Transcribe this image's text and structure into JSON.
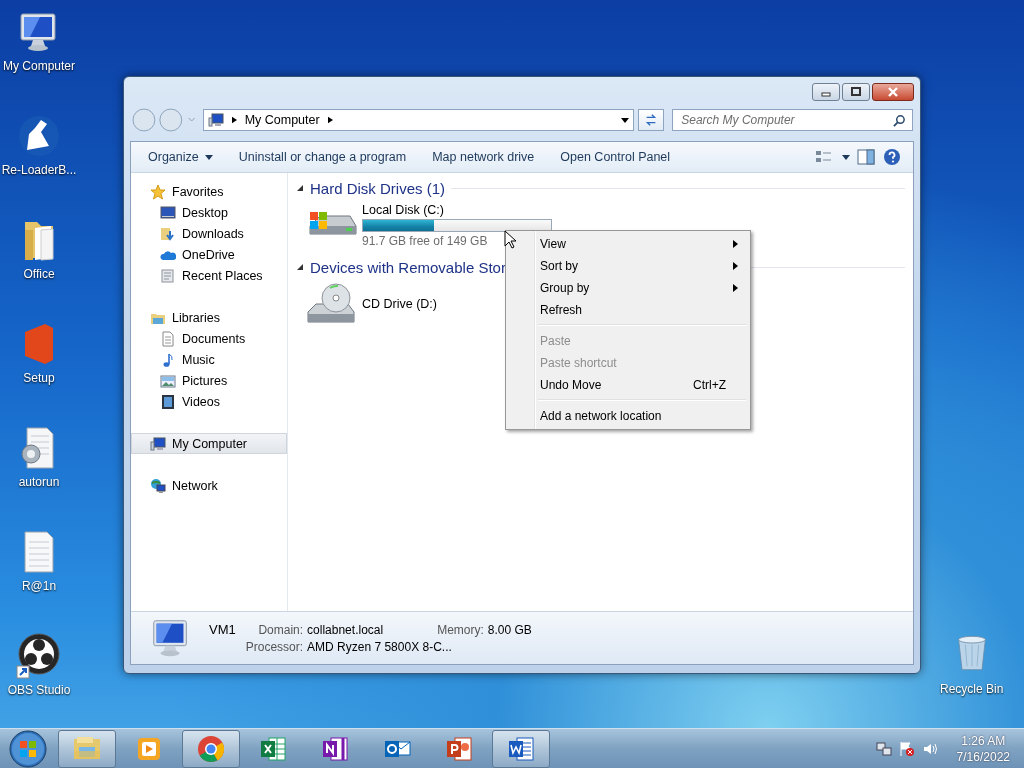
{
  "desktop_icons": [
    {
      "label": "My Computer",
      "kind": "computer"
    },
    {
      "label": "Re-LoaderB...",
      "kind": "flask"
    },
    {
      "label": "Office",
      "kind": "folder"
    },
    {
      "label": "Setup",
      "kind": "office"
    },
    {
      "label": "autorun",
      "kind": "settings-file"
    },
    {
      "label": "R@1n",
      "kind": "file"
    },
    {
      "label": "OBS Studio",
      "kind": "obs"
    }
  ],
  "recycle_bin": {
    "label": "Recycle Bin"
  },
  "window": {
    "address": {
      "path": "My Computer"
    },
    "search": {
      "placeholder": "Search My Computer"
    },
    "toolbar": [
      {
        "label": "Organize",
        "kind": "menu"
      },
      {
        "label": "Uninstall or change a program",
        "kind": "command"
      },
      {
        "label": "Map network drive",
        "kind": "command"
      },
      {
        "label": "Open Control Panel",
        "kind": "command"
      }
    ],
    "sidebar": {
      "items": [
        {
          "label": "Favorites",
          "kind": "star",
          "selected": false,
          "children": [
            {
              "label": "Desktop",
              "kind": "desktop",
              "selected": false
            },
            {
              "label": "Downloads",
              "kind": "downloads",
              "selected": false
            },
            {
              "label": "OneDrive",
              "kind": "cloud",
              "selected": false
            },
            {
              "label": "Recent Places",
              "kind": "recent",
              "selected": false
            }
          ]
        },
        {
          "label": "Libraries",
          "kind": "library",
          "selected": false,
          "children": [
            {
              "label": "Documents",
              "kind": "document",
              "selected": false
            },
            {
              "label": "Music",
              "kind": "music",
              "selected": false
            },
            {
              "label": "Pictures",
              "kind": "pictures",
              "selected": false
            },
            {
              "label": "Videos",
              "kind": "videos",
              "selected": false
            }
          ]
        },
        {
          "label": "My Computer",
          "kind": "computer",
          "selected": true
        },
        {
          "label": "Network",
          "kind": "network",
          "selected": false
        }
      ]
    },
    "groups": [
      {
        "title": "Hard Disk Drives (1)",
        "items": [
          {
            "name": "Local Disk (C:)",
            "kind": "hdd",
            "level": 0.38,
            "free": "91.7 GB free of 149 GB"
          }
        ]
      },
      {
        "title": "Devices with Removable Stor",
        "items": [
          {
            "name": "CD Drive (D:)",
            "kind": "cd"
          }
        ]
      }
    ],
    "details": {
      "name": "VM1",
      "fields": [
        {
          "label": "Domain:",
          "value": "collabnet.local"
        },
        {
          "label": "Memory:",
          "value": "8.00 GB"
        },
        {
          "label": "Processor:",
          "value": "AMD Ryzen 7 5800X 8-C..."
        }
      ]
    }
  },
  "context_menu": {
    "items": [
      {
        "label": "View",
        "kind": "submenu",
        "disabled": false
      },
      {
        "label": "Sort by",
        "kind": "submenu",
        "disabled": false
      },
      {
        "label": "Group by",
        "kind": "submenu",
        "disabled": false
      },
      {
        "label": "Refresh",
        "kind": "command",
        "disabled": false
      },
      {
        "kind": "separator"
      },
      {
        "label": "Paste",
        "kind": "command",
        "disabled": true
      },
      {
        "label": "Paste shortcut",
        "kind": "command",
        "disabled": true
      },
      {
        "label": "Undo Move",
        "kind": "command",
        "disabled": false,
        "shortcut": "Ctrl+Z"
      },
      {
        "kind": "separator"
      },
      {
        "label": "Add a network location",
        "kind": "command",
        "disabled": false
      }
    ]
  },
  "taskbar": {
    "apps": [
      {
        "kind": "explorer",
        "open": true
      },
      {
        "kind": "media",
        "open": false
      },
      {
        "kind": "browser",
        "open": true
      },
      {
        "kind": "spreadsheet",
        "open": false
      },
      {
        "kind": "notebook",
        "open": false
      },
      {
        "kind": "mail",
        "open": false
      },
      {
        "kind": "slides",
        "open": false
      },
      {
        "kind": "wordproc",
        "open": true
      }
    ],
    "clock": {
      "time": "1:26 AM",
      "date": "7/16/2022"
    }
  }
}
